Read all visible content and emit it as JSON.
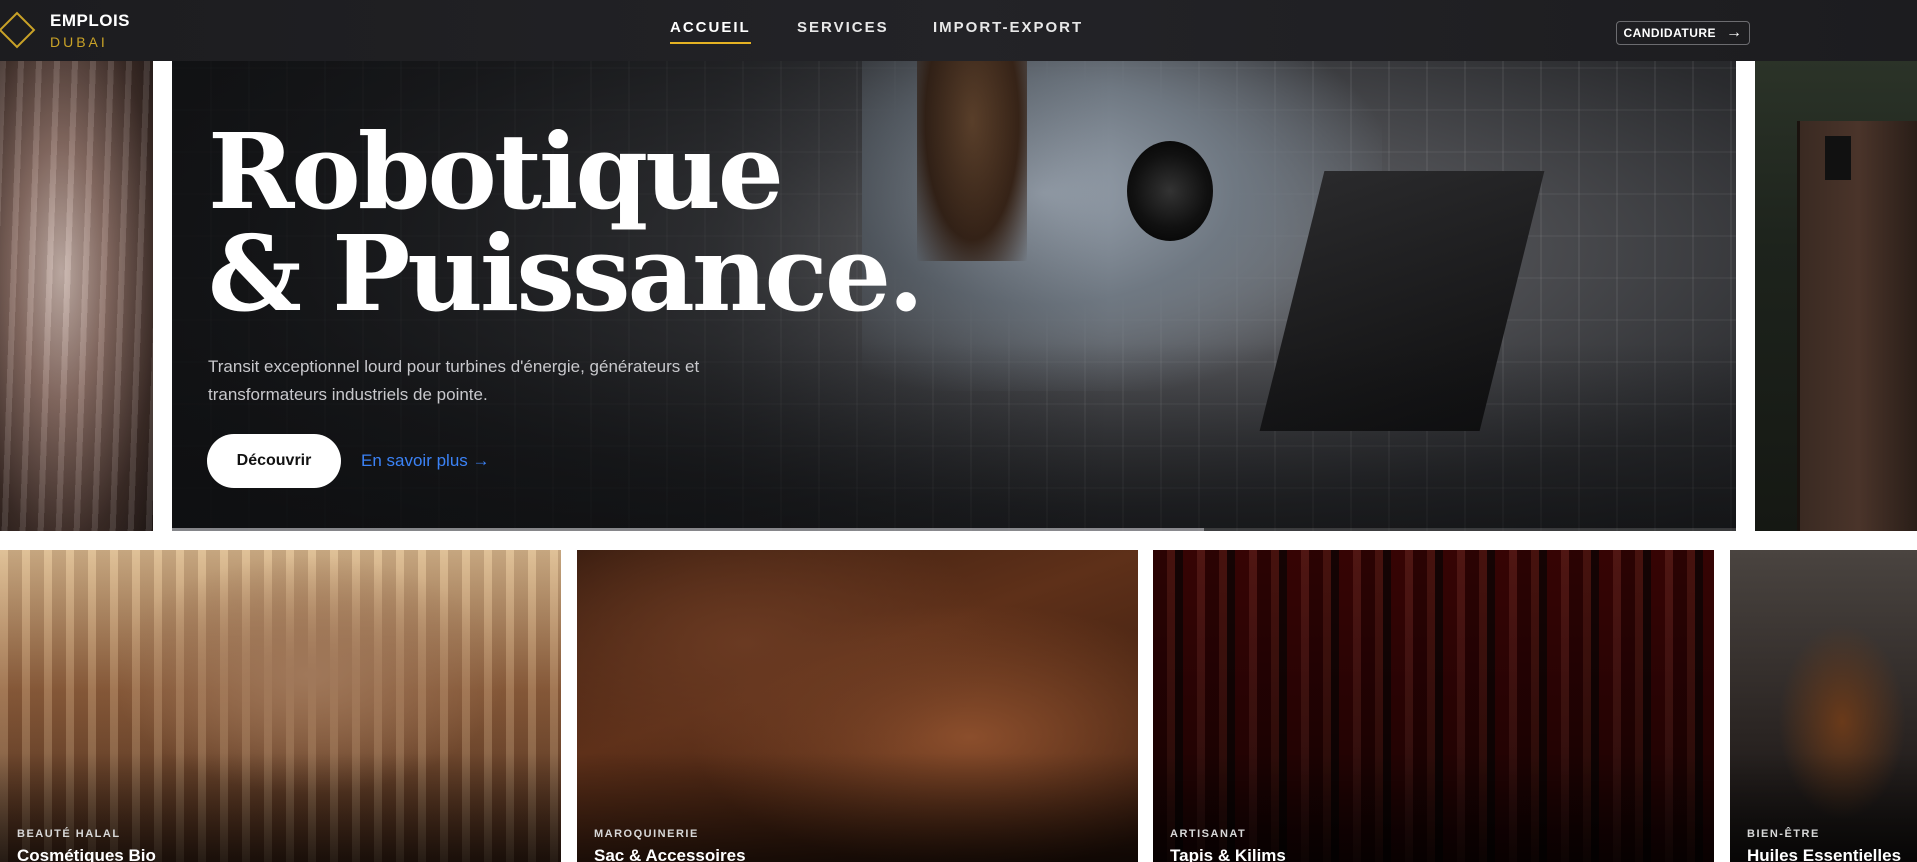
{
  "brand": {
    "line1": "EMPLOIS",
    "line2": "DUBAI",
    "accent_color": "#c9a227"
  },
  "nav": {
    "items": [
      {
        "label": "ACCUEIL",
        "active": true
      },
      {
        "label": "SERVICES",
        "active": false
      },
      {
        "label": "IMPORT-EXPORT",
        "active": false
      }
    ],
    "cta_label": "CANDIDATURE",
    "cta_icon": "arrow-right-icon"
  },
  "hero": {
    "title": "Robotique\n& Puissance.",
    "subtitle": "Transit exceptionnel lourd pour turbines d'énergie, générateurs et transformateurs industriels de pointe.",
    "primary_button": "Découvrir",
    "secondary_link": "En savoir plus →",
    "slide_progress": 0.66,
    "link_color": "#3b82f6"
  },
  "cards": [
    {
      "category": "BEAUTÉ HALAL",
      "title": "Cosmétiques Bio"
    },
    {
      "category": "MAROQUINERIE",
      "title": "Sac & Accessoires"
    },
    {
      "category": "ARTISANAT",
      "title": "Tapis & Kilims"
    },
    {
      "category": "BIEN-ÊTRE",
      "title": "Huiles Essentielles"
    }
  ]
}
